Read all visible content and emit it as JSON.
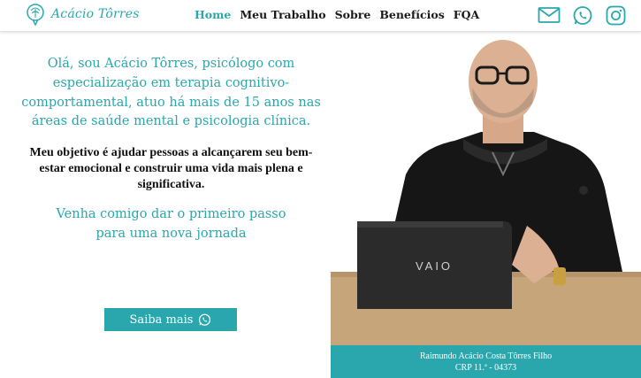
{
  "brand": {
    "name": "Acácio Tôrres",
    "accent": "#2aa7ad"
  },
  "nav": {
    "items": [
      {
        "label": "Home",
        "active": true
      },
      {
        "label": "Meu Trabalho",
        "active": false
      },
      {
        "label": "Sobre",
        "active": false
      },
      {
        "label": "Benefícios",
        "active": false
      },
      {
        "label": "FQA",
        "active": false
      }
    ]
  },
  "social": {
    "icons": [
      "email-icon",
      "whatsapp-icon",
      "instagram-icon"
    ]
  },
  "hero": {
    "title": "Olá, sou Acácio Tôrres, psicólogo com especialização em terapia cognitivo-comportamental, atuo há mais de 15 anos nas áreas de saúde mental e psicologia clínica.",
    "description": "Meu objetivo é ajudar pessoas a alcançarem seu bem-estar emocional e construir uma vida mais plena e significativa.",
    "cta_text": "Venha comigo dar o primeiro passo para uma nova jornada",
    "button_label": "Saiba mais"
  },
  "photo": {
    "laptop_brand": "VAIO",
    "caption_name": "Raimundo Acácio Costa Tôrres Filho",
    "caption_crp": "CRP 11.ª - 04373"
  }
}
